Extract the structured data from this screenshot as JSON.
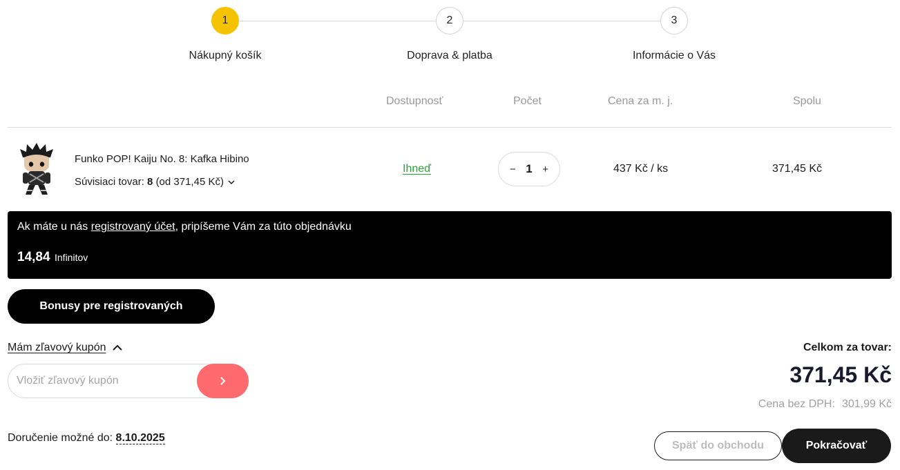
{
  "stepper": {
    "steps": [
      {
        "number": "1",
        "label": "Nákupný košík",
        "active": true
      },
      {
        "number": "2",
        "label": "Doprava & platba",
        "active": false
      },
      {
        "number": "3",
        "label": "Informácie o Vás",
        "active": false
      }
    ]
  },
  "table": {
    "headers": [
      "Dostupnosť",
      "Počet",
      "Cena za m. j.",
      "Spolu"
    ]
  },
  "product": {
    "name": "Funko POP! Kaiju No. 8: Kafka Hibino",
    "related_label": "Súvisiaci tovar:",
    "related_count": "8",
    "related_from": "(od 371,45 Kč)",
    "availability": "Ihneď",
    "quantity": "1",
    "minus": "−",
    "plus": "+",
    "unit_price": "437 Kč / ks",
    "total": "371,45 Kč"
  },
  "banner": {
    "prefix": "Ak máte u nás",
    "link": "registrovaný účet",
    "suffix": ", pripíšeme Vám za túto objednávku",
    "points": "14,84",
    "points_unit": "Infinitov"
  },
  "bonus_button": "Bonusy pre registrovaných",
  "coupon": {
    "toggle_label": "Mám zľavový kupón",
    "placeholder": "Vložiť zľavový kupón"
  },
  "totals": {
    "label": "Celkom za tovar:",
    "value": "371,45 Kč",
    "vat_label": "Cena bez DPH:",
    "vat_value": "301,99 Kč"
  },
  "delivery": {
    "label": "Doručenie možné do:",
    "date": "8.10.2025"
  },
  "buttons": {
    "back": "Späť do obchodu",
    "continue": "Pokračovať"
  },
  "colors": {
    "accent_step": "#f5c200",
    "availability": "#26a635",
    "coupon_submit": "#ff6a6e",
    "banner_bg": "#000000"
  }
}
